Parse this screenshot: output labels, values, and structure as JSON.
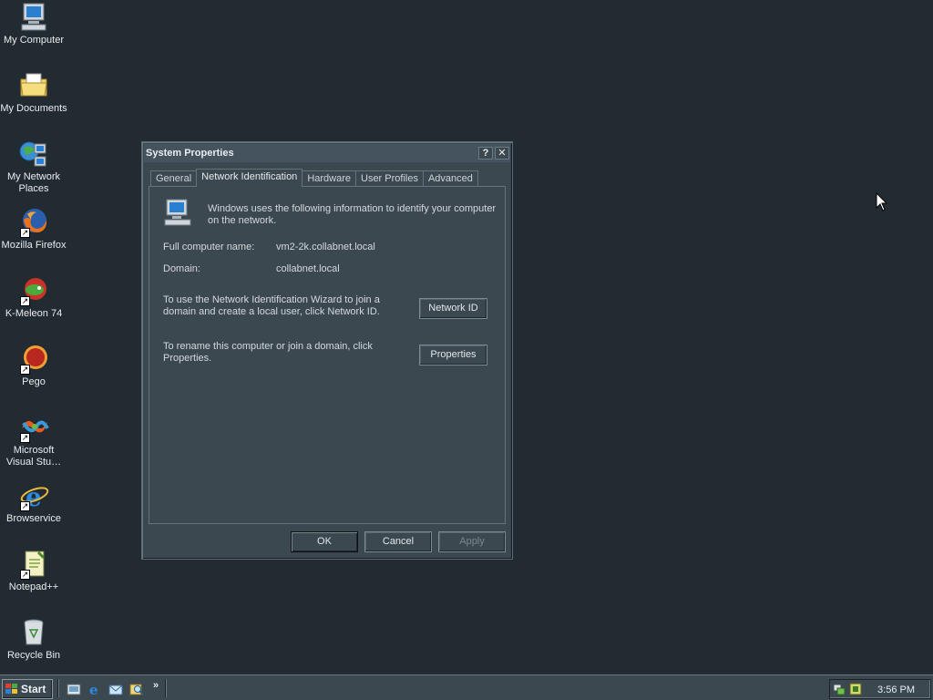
{
  "desktop": {
    "icons": [
      {
        "label": "My Computer",
        "icon": "my-computer-icon"
      },
      {
        "label": "My Documents",
        "icon": "folder-icon"
      },
      {
        "label": "My Network Places",
        "icon": "network-places-icon"
      },
      {
        "label": "Mozilla Firefox",
        "icon": "firefox-icon"
      },
      {
        "label": "K-Meleon 74",
        "icon": "kmeleon-icon"
      },
      {
        "label": "Pego",
        "icon": "pego-icon"
      },
      {
        "label": "Microsoft Visual Stu…",
        "icon": "visual-studio-icon"
      },
      {
        "label": "Browservice",
        "icon": "internet-explorer-icon"
      },
      {
        "label": "Notepad++",
        "icon": "notepadpp-icon"
      },
      {
        "label": "Recycle Bin",
        "icon": "recycle-bin-icon"
      }
    ]
  },
  "dialog": {
    "title": "System Properties",
    "help_btn": "?",
    "close_btn": "✕",
    "tabs": [
      "General",
      "Network Identification",
      "Hardware",
      "User Profiles",
      "Advanced"
    ],
    "active_tab": "Network Identification",
    "info": "Windows uses the following information to identify your computer on the network.",
    "full_name_label": "Full computer name:",
    "full_name_value": "vm2-2k.collabnet.local",
    "domain_label": "Domain:",
    "domain_value": "collabnet.local",
    "wizard_text": "To use the Network Identification Wizard to join a domain and create a local user, click Network ID.",
    "network_id_btn": "Network ID",
    "rename_text": "To rename this computer or join a domain, click Properties.",
    "properties_btn": "Properties",
    "ok_btn": "OK",
    "cancel_btn": "Cancel",
    "apply_btn": "Apply"
  },
  "taskbar": {
    "start_label": "Start",
    "chevron": "»",
    "clock": "3:56 PM"
  },
  "colors": {
    "desktop": "#222b31",
    "window": "#3c4850",
    "titlebar": "#44535d"
  }
}
